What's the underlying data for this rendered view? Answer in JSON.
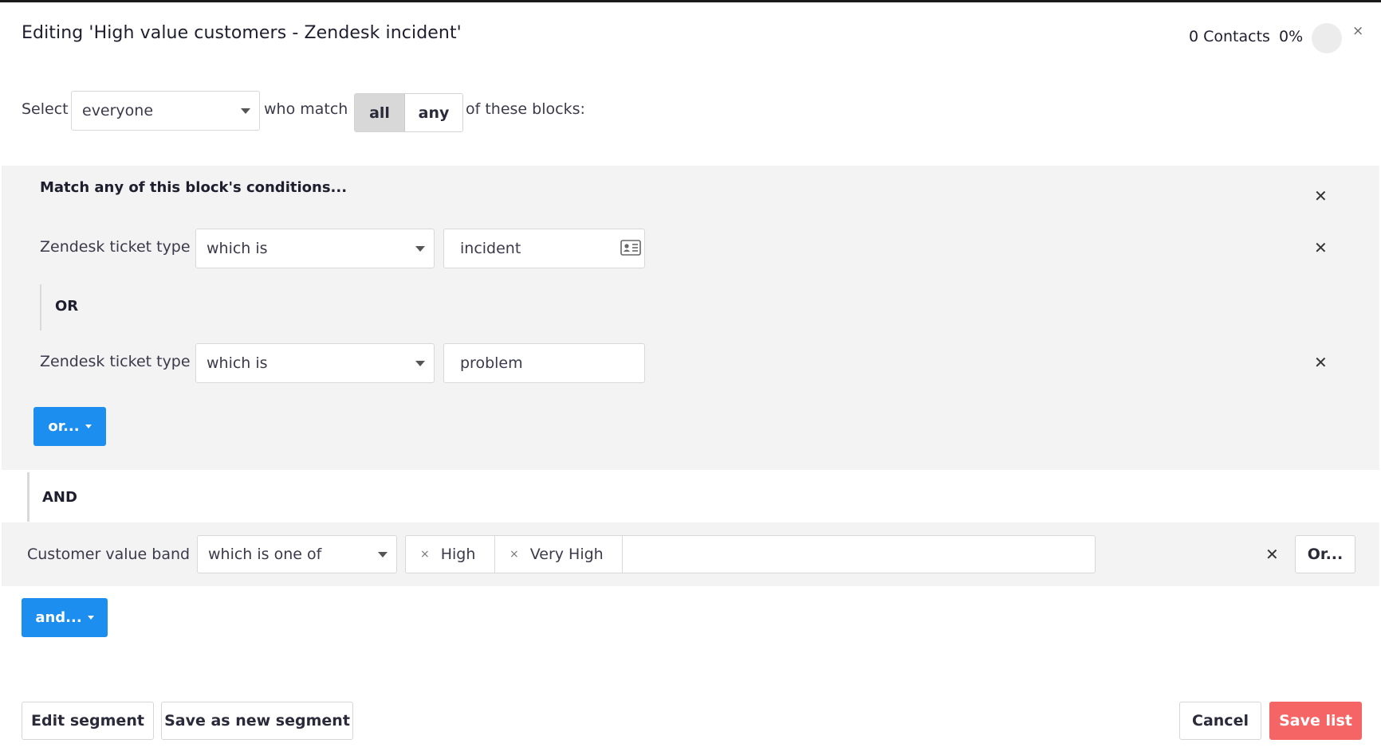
{
  "dialog": {
    "title": "Editing 'High value customers - Zendesk incident'",
    "contacts_label": "0 Contacts",
    "percent_label": "0%",
    "close_glyph": "×"
  },
  "selector": {
    "select_label": "Select",
    "audience_value": "everyone",
    "who_match_label": "who match",
    "match_options": [
      "all",
      "any"
    ],
    "match_selected": "all",
    "suffix": "of these blocks:"
  },
  "blocks": [
    {
      "heading": "Match any of this block's conditions...",
      "conditions": [
        {
          "field": "Zendesk ticket type",
          "operator": "which is",
          "value": "incident",
          "icon": "contact-card-icon"
        },
        {
          "field": "Zendesk ticket type",
          "operator": "which is",
          "value": "problem"
        }
      ],
      "inner_connector": "OR",
      "or_button": "or..."
    },
    {
      "connector": "AND",
      "field": "Customer value band",
      "operator": "which is one of",
      "tags": [
        "High",
        "Very High"
      ],
      "or_button": "Or..."
    }
  ],
  "and_button": "and...",
  "footer": {
    "edit_segment": "Edit segment",
    "save_new_segment": "Save as new segment",
    "cancel": "Cancel",
    "save_list": "Save list"
  },
  "colors": {
    "primary_blue": "#1c8ef0",
    "danger_red": "#f56565",
    "block_bg": "#f3f3f3"
  }
}
